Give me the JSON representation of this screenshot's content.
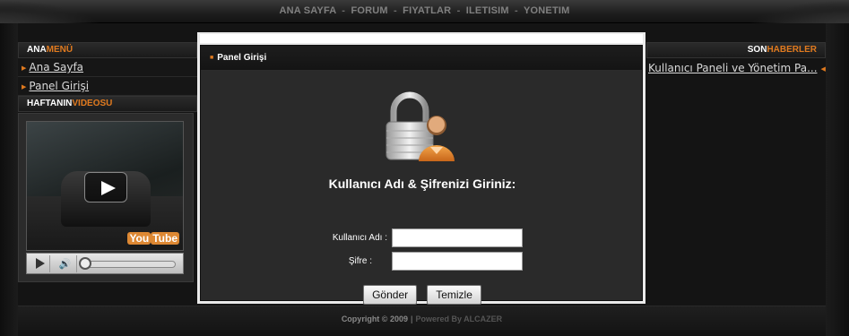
{
  "header": {
    "nav": [
      "ANA SAYFA",
      "FORUM",
      "FIYATLAR",
      "ILETISIM",
      "YONETIM"
    ],
    "separator": "-"
  },
  "left": {
    "menu_title_a": "ANA",
    "menu_title_b": "MENÜ",
    "menu_items": [
      "Ana Sayfa",
      "Panel Girişi"
    ],
    "video_title_a": "HAFTANIN",
    "video_title_b": "VIDEOSU",
    "video_brand_a": "You",
    "video_brand_b": "Tube"
  },
  "panel": {
    "title": "Panel Girişi",
    "heading": "Kullanıcı Adı & Şifrenizi Giriniz:",
    "username_label": "Kullanıcı Adı :",
    "password_label": "Şifre :",
    "username_value": "",
    "password_value": "",
    "submit_label": "Gönder",
    "reset_label": "Temizle"
  },
  "right": {
    "title_a": "SON",
    "title_b": "HABERLER",
    "news_items": [
      "Kullanıcı Paneli ve Yönetim Pa..."
    ]
  },
  "footer": {
    "copyright": "Copyright © 2009",
    "separator": "|",
    "powered": "Powered By ALCAZER"
  },
  "colors": {
    "accent": "#e07a1f",
    "background": "#111111",
    "panel": "#2a2a2a"
  },
  "icons": [
    "lock-user-icon",
    "play-icon",
    "volume-icon",
    "arrow-icon"
  ]
}
